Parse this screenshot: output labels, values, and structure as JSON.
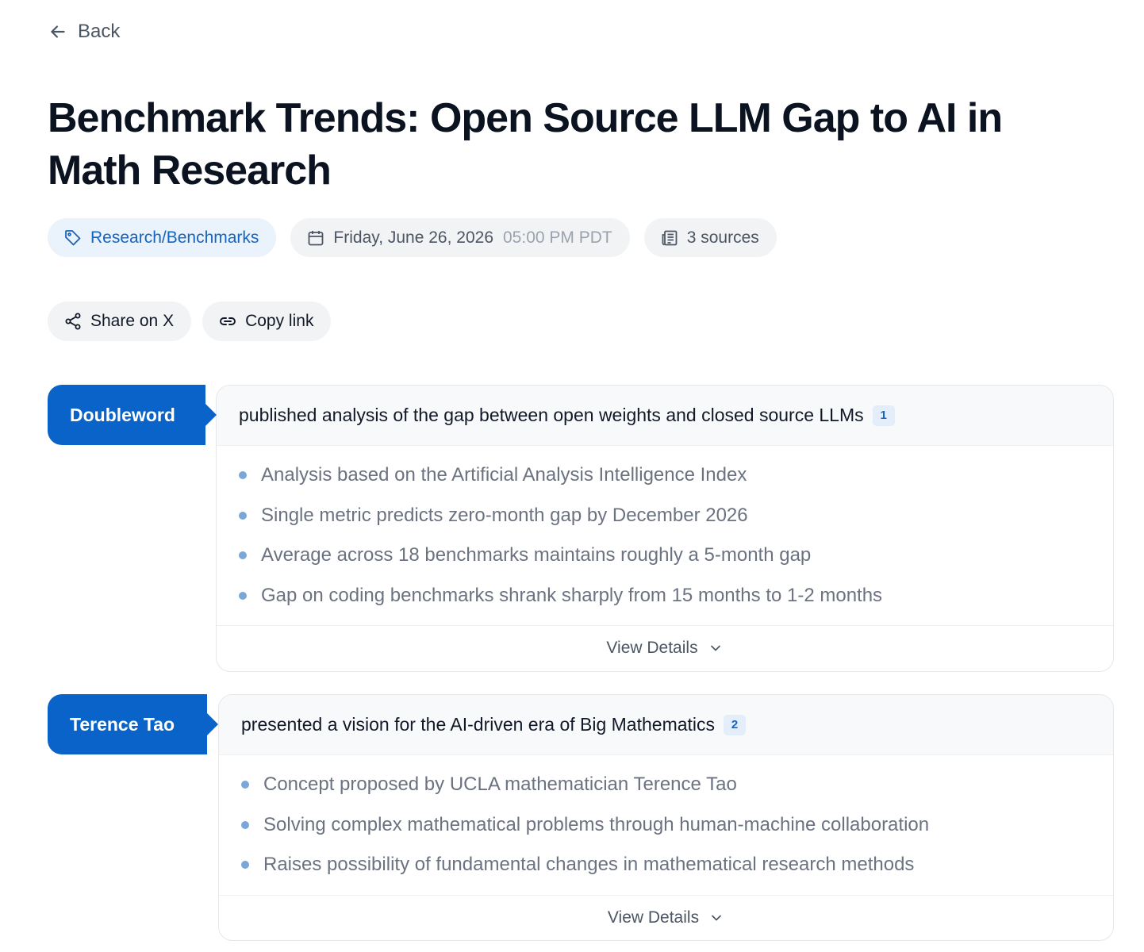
{
  "nav": {
    "back_label": "Back"
  },
  "title": "Benchmark Trends: Open Source LLM Gap to AI in Math Research",
  "meta": {
    "category": "Research/Benchmarks",
    "date": "Friday, June 26, 2026",
    "time": "05:00 PM PDT",
    "sources": "3 sources"
  },
  "actions": {
    "share_label": "Share on X",
    "copy_label": "Copy link"
  },
  "entries": [
    {
      "actor": "Doubleword",
      "headline": "published analysis of the gap between open weights and closed source LLMs",
      "citation": "1",
      "bullets": [
        "Analysis based on the Artificial Analysis Intelligence Index",
        "Single metric predicts zero-month gap by December 2026",
        "Average across 18 benchmarks maintains roughly a 5-month gap",
        "Gap on coding benchmarks shrank sharply from 15 months to 1-2 months"
      ],
      "details_label": "View Details"
    },
    {
      "actor": "Terence Tao",
      "headline": "presented a vision for the AI-driven era of Big Mathematics",
      "citation": "2",
      "bullets": [
        "Concept proposed by UCLA mathematician Terence Tao",
        "Solving complex mathematical problems through human-machine collaboration",
        "Raises possibility of fundamental changes in mathematical research methods"
      ],
      "details_label": "View Details"
    }
  ],
  "colors": {
    "accent": "#0a63c8",
    "category_text": "#1565c0",
    "bullet_dot": "#7aa7d8"
  },
  "icons": {
    "back": "arrow-left-icon",
    "category": "tag-icon",
    "date": "calendar-icon",
    "sources": "newspaper-icon",
    "share": "share-icon",
    "copy": "link-icon",
    "expand": "chevron-down-icon"
  }
}
